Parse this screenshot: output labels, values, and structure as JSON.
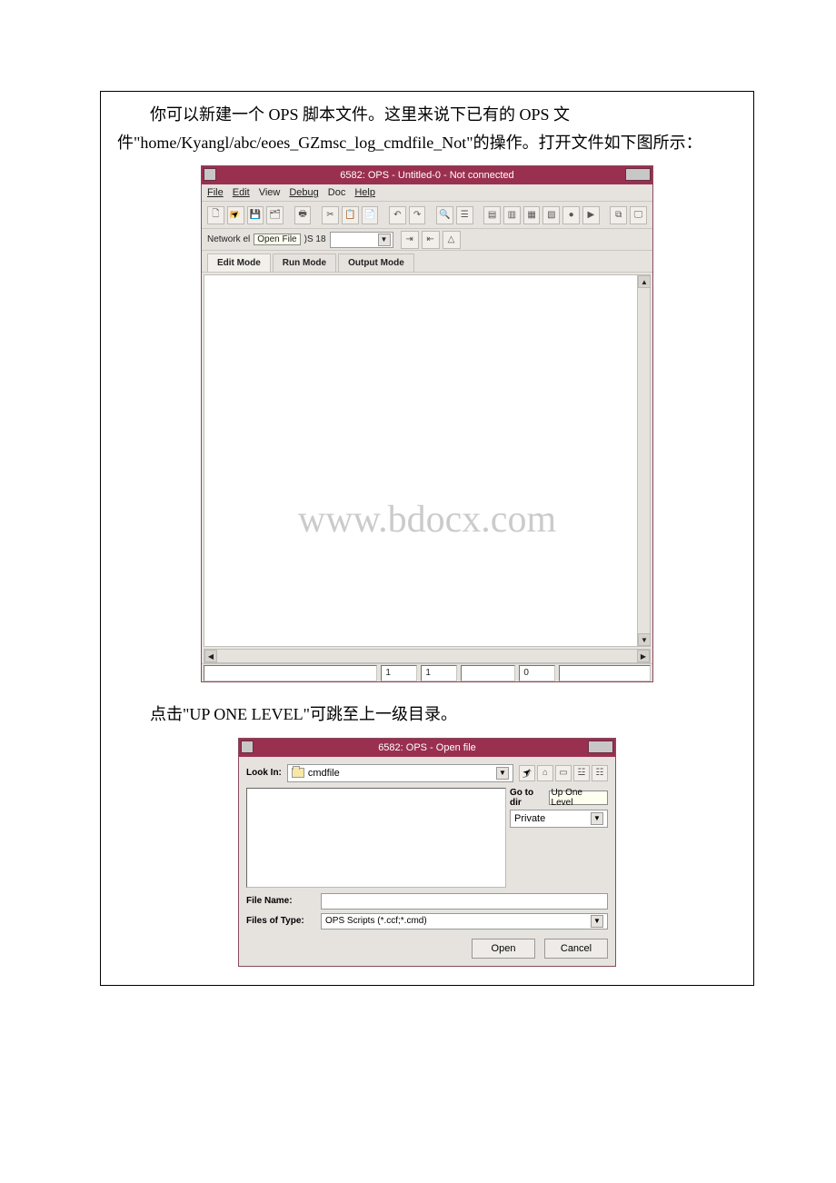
{
  "para1": "你可以新建一个 OPS 脚本文件。这里来说下已有的 OPS 文件\"home/Kyangl/abc/eoes_GZmsc_log_cmdfile_Not\"的操作。打开文件如下图所示：",
  "para2": "点击\"UP ONE LEVEL\"可跳至上一级目录。",
  "watermark": "www.bdocx.com",
  "ops": {
    "title": "6582: OPS - Untitled-0 - Not connected",
    "menu": {
      "file": "File",
      "edit": "Edit",
      "view": "View",
      "debug": "Debug",
      "doc": "Doc",
      "help": "Help"
    },
    "network_label": "Network el",
    "open_file_tooltip": "Open File",
    "ne_suffix": ")S 18",
    "tabs": {
      "edit": "Edit Mode",
      "run": "Run Mode",
      "output": "Output Mode"
    },
    "status": {
      "c1": "1",
      "c2": "1",
      "c3": "0"
    }
  },
  "dlg": {
    "title": "6582: OPS - Open file",
    "lookin_label": "Look In:",
    "lookin_value": "cmdfile",
    "goto_label": "Go to dir",
    "up_one_level": "Up One Level",
    "private": "Private",
    "filename_label": "File Name:",
    "filename_value": "",
    "filetype_label": "Files of Type:",
    "filetype_value": "OPS Scripts (*.ccf;*.cmd)",
    "open": "Open",
    "cancel": "Cancel"
  }
}
